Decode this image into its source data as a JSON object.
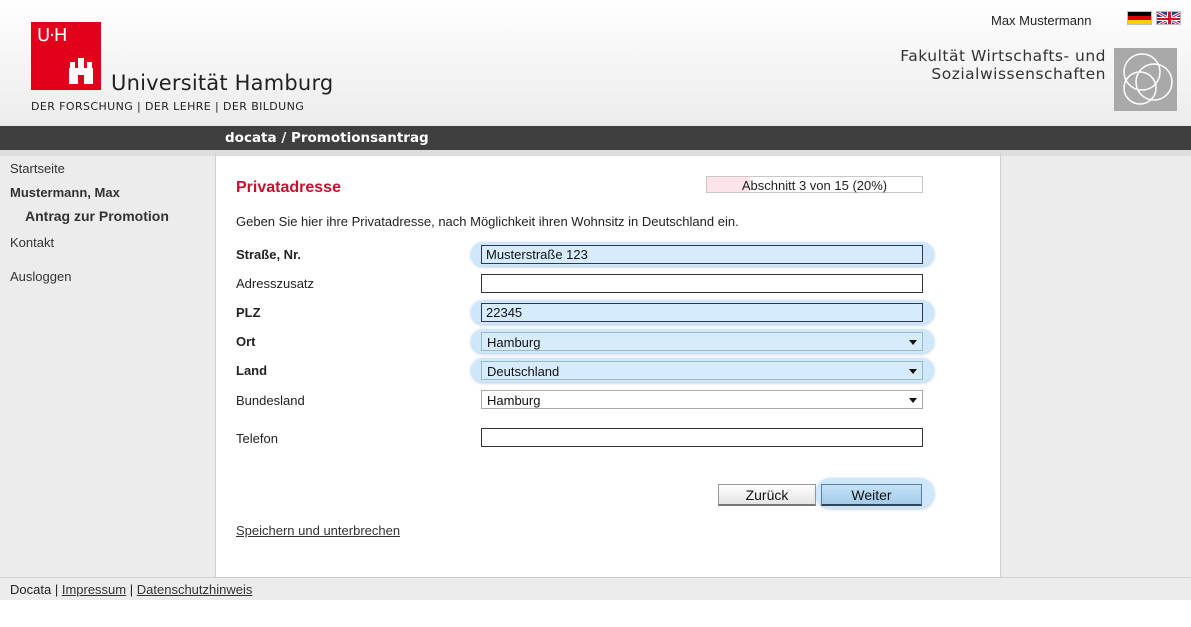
{
  "header": {
    "university_logo_text": "UHH",
    "university_name": "Universität Hamburg",
    "slogan": "DER FORSCHUNG  |  DER LEHRE  |  DER BILDUNG",
    "user_name": "Max Mustermann",
    "faculty_line1": "Fakultät Wirtschafts- und",
    "faculty_line2": "Sozialwissenschaften",
    "languages": [
      "de-flag-icon",
      "en-flag-icon"
    ]
  },
  "titlebar": {
    "title": "docata / Promotionsantrag"
  },
  "sidebar": {
    "start": "Startseite",
    "user": "Mustermann, Max",
    "antrag": "Antrag zur Promotion",
    "kontakt": "Kontakt",
    "logout": "Ausloggen"
  },
  "main": {
    "section_title": "Privatadresse",
    "progress_text": "Abschnitt 3 von 15 (20%)",
    "progress_percent": 20,
    "intro": "Geben Sie hier ihre Privatadresse, nach Möglichkeit ihren Wohnsitz in Deutschland ein.",
    "fields": {
      "strasse": {
        "label": "Straße, Nr.",
        "value": "Musterstraße 123"
      },
      "adresszusatz": {
        "label": "Adresszusatz",
        "value": ""
      },
      "plz": {
        "label": "PLZ",
        "value": "22345"
      },
      "ort": {
        "label": "Ort",
        "value": "Hamburg"
      },
      "land": {
        "label": "Land",
        "value": "Deutschland"
      },
      "bundesland": {
        "label": "Bundesland",
        "value": "Hamburg"
      },
      "telefon": {
        "label": "Telefon",
        "value": ""
      }
    },
    "back_label": "Zurück",
    "next_label": "Weiter",
    "save_link": "Speichern und unterbrechen"
  },
  "footer": {
    "brand": "Docata",
    "impressum": "Impressum",
    "datenschutz": "Datenschutzhinweis"
  },
  "colors": {
    "accent_red": "#c8102e",
    "titlebar": "#3f3f3f",
    "highlight_blue": "#d6ecfd"
  }
}
